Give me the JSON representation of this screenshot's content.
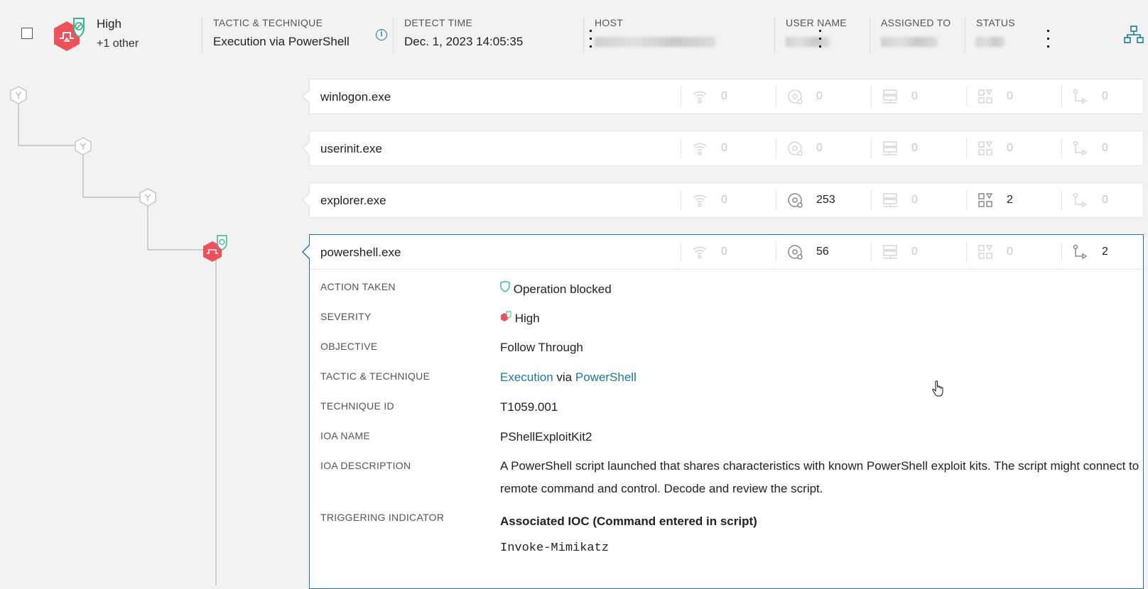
{
  "header": {
    "severity": "High",
    "severity_other": "+1 other",
    "columns": {
      "tactic_label": "TACTIC & TECHNIQUE",
      "tactic_value": "Execution via PowerShell",
      "detect_label": "DETECT TIME",
      "detect_value": "Dec. 1, 2023 14:05:35",
      "host_label": "HOST",
      "user_label": "USER NAME",
      "assigned_label": "ASSIGNED TO",
      "status_label": "STATUS"
    }
  },
  "processes": [
    {
      "name": "winlogon.exe",
      "metrics": [
        "0",
        "0",
        "0",
        "0",
        "0"
      ]
    },
    {
      "name": "userinit.exe",
      "metrics": [
        "0",
        "0",
        "0",
        "0",
        "0"
      ]
    },
    {
      "name": "explorer.exe",
      "metrics": [
        "0",
        "253",
        "0",
        "2",
        "0"
      ]
    },
    {
      "name": "powershell.exe",
      "metrics": [
        "0",
        "56",
        "0",
        "0",
        "2"
      ]
    }
  ],
  "details": {
    "action_label": "ACTION TAKEN",
    "action_value": "Operation blocked",
    "severity_label": "SEVERITY",
    "severity_value": "High",
    "objective_label": "OBJECTIVE",
    "objective_value": "Follow Through",
    "tactic_label": "TACTIC & TECHNIQUE",
    "tactic_part1": "Execution",
    "tactic_via": "via",
    "tactic_part2": "PowerShell",
    "technique_id_label": "TECHNIQUE ID",
    "technique_id_value": "T1059.001",
    "ioa_name_label": "IOA NAME",
    "ioa_name_value": "PShellExploitKit2",
    "ioa_desc_label": "IOA DESCRIPTION",
    "ioa_desc_value": "A PowerShell script launched that shares characteristics with known PowerShell exploit kits. The script might connect to remote command and control. Decode and review the script.",
    "trigger_label": "TRIGGERING INDICATOR",
    "trigger_heading": "Associated IOC (Command entered in script)",
    "trigger_value": "Invoke-Mimikatz"
  },
  "colors": {
    "accent": "#1a7a9a",
    "high_severity": "#f0505a",
    "shield": "#2eb88a"
  },
  "icons": [
    "network-icon",
    "disk-icon",
    "registry-icon",
    "apps-icon",
    "process-flow-icon",
    "shield-icon",
    "process-tree-icon",
    "info-icon"
  ]
}
